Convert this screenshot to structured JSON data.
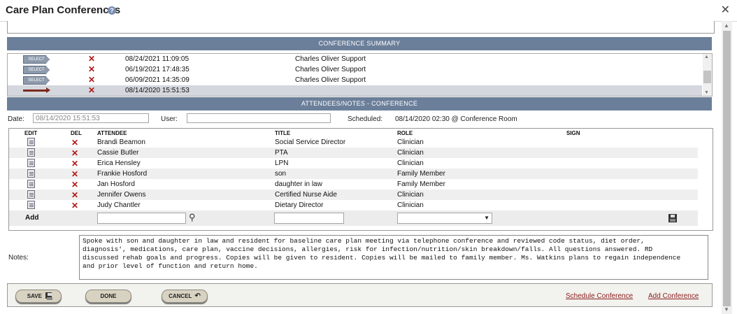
{
  "window": {
    "title": "Care Plan Conferences",
    "help_glyph": "?",
    "close_glyph": "✕"
  },
  "summary": {
    "header": "CONFERENCE SUMMARY",
    "select_label": "SELECT",
    "rows": [
      {
        "date": "08/24/2021 11:09:05",
        "user": "Charles Oliver Support",
        "selected": false
      },
      {
        "date": "06/19/2021 17:48:35",
        "user": "Charles Oliver Support",
        "selected": false
      },
      {
        "date": "06/09/2021 14:35:09",
        "user": "Charles Oliver Support",
        "selected": false
      },
      {
        "date": "08/14/2020 15:51:53",
        "user": "",
        "selected": true
      }
    ]
  },
  "attendees_section": {
    "header": "ATTENDEES/NOTES - CONFERENCE",
    "date_label": "Date:",
    "date_value": "08/14/2020 15:51:53",
    "user_label": "User:",
    "user_value": "",
    "scheduled_label": "Scheduled:",
    "scheduled_value": "08/14/2020 02:30 @ Conference Room"
  },
  "attendees": {
    "columns": {
      "edit": "EDIT",
      "del": "DEL",
      "attendee": "ATTENDEE",
      "title": "TITLE",
      "role": "ROLE",
      "sign": "SIGN"
    },
    "rows": [
      {
        "attendee": "Brandi Beamon",
        "title": "Social Service Director",
        "role": "Clinician"
      },
      {
        "attendee": "Cassie Butler",
        "title": "PTA",
        "role": "Clinician"
      },
      {
        "attendee": "Erica Hensley",
        "title": "LPN",
        "role": "Clinician"
      },
      {
        "attendee": "Frankie Hosford",
        "title": "son",
        "role": "Family Member"
      },
      {
        "attendee": "Jan Hosford",
        "title": "daughter in law",
        "role": "Family Member"
      },
      {
        "attendee": "Jennifer Owens",
        "title": "Certified Nurse Aide",
        "role": "Clinician"
      },
      {
        "attendee": "Judy Chantler",
        "title": "Dietary Director",
        "role": "Clinician"
      }
    ],
    "add_label": "Add",
    "add_name_value": "",
    "add_title_value": "",
    "add_role_value": ""
  },
  "notes": {
    "label": "Notes:",
    "text": "Spoke with son and daughter in law and resident for baseline care plan meeting via telephone conference and reviewed code status, diet order,\ndiagnosis', medications, care plan, vaccine decisions, allergies, risk for infection/nutrition/skin breakdown/falls. All questions answered. RD\ndiscussed rehab goals and progress. Copies will be given to resident. Copies will be mailed to family member. Ms. Watkins plans to regain independence\nand prior level of function and return home."
  },
  "footer": {
    "save_label": "SAVE",
    "done_label": "DONE",
    "cancel_label": "CANCEL",
    "schedule_link": "Schedule Conference",
    "add_link": "Add Conference"
  },
  "icons": {
    "delete": "✕",
    "search": "⚲",
    "undo": "↶",
    "scroll_up": "▲",
    "scroll_down": "▼",
    "dropdown": "▼"
  }
}
